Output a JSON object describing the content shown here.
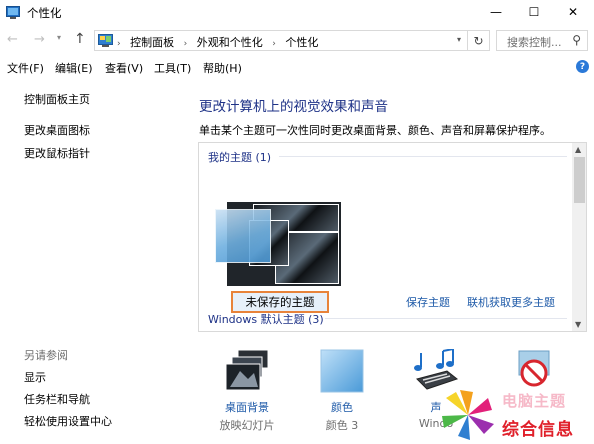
{
  "window": {
    "title": "个性化",
    "minimize_glyph": "—",
    "maximize_glyph": "☐",
    "close_glyph": "✕"
  },
  "nav": {
    "back_glyph": "←",
    "forward_glyph": "→",
    "dropdown_glyph": "▾",
    "up_glyph": "↑",
    "refresh_glyph": "↻"
  },
  "address": {
    "crumbs": [
      "控制面板",
      "外观和个性化",
      "个性化"
    ],
    "separator": "›",
    "dropdown_glyph": "▾"
  },
  "search": {
    "placeholder": "搜索控制...",
    "icon_glyph": "⚲"
  },
  "menu": {
    "items": [
      "文件(F)",
      "编辑(E)",
      "查看(V)",
      "工具(T)",
      "帮助(H)"
    ],
    "help_icon": "?"
  },
  "sidebar": {
    "links": [
      "控制面板主页",
      "更改桌面图标",
      "更改鼠标指针"
    ],
    "see_also_heading": "另请参阅",
    "see_also": [
      "显示",
      "任务栏和导航",
      "轻松使用设置中心"
    ]
  },
  "main": {
    "heading": "更改计算机上的视觉效果和声音",
    "description": "单击某个主题可一次性同时更改桌面背景、颜色、声音和屏幕保护程序。"
  },
  "themes": {
    "my_themes_header": "我的主题 (1)",
    "unsaved_theme_label": "未保存的主题",
    "save_theme_link": "保存主题",
    "get_more_link": "联机获取更多主题",
    "default_themes_header": "Windows 默认主题 (3)"
  },
  "bottom_items": [
    {
      "label": "桌面背景",
      "sub": "放映幻灯片",
      "icon": "desktop-background-icon"
    },
    {
      "label": "颜色",
      "sub": "颜色 3",
      "icon": "color-icon"
    },
    {
      "label": "声",
      "sub": "Windo",
      "icon": "sound-icon"
    },
    {
      "label": "",
      "sub": "",
      "icon": "screensaver-icon"
    }
  ],
  "watermark": {
    "line1": "电脑主题",
    "line2": "综合信息"
  },
  "colors": {
    "heading_blue": "#1e3287",
    "link_blue": "#1e5aa8",
    "highlight_orange": "#e8833a",
    "selection_blue": "#e7f0fa"
  }
}
